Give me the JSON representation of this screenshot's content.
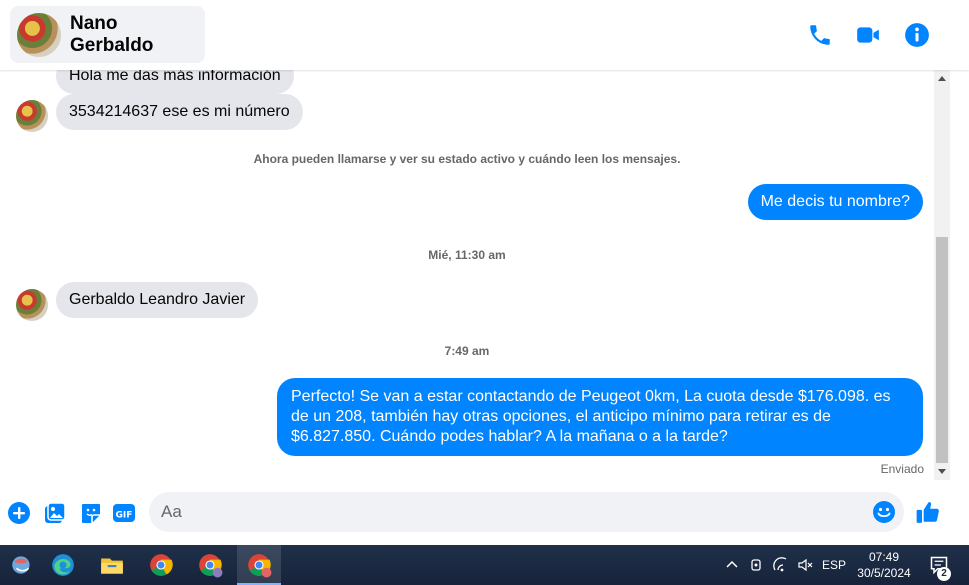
{
  "header": {
    "contact_name": "Nano Gerbaldo"
  },
  "messages": {
    "m1": "Hola me das más información",
    "m2": "3534214637 ese es mi número",
    "system_notice": "Ahora pueden llamarse y ver su estado activo y cuándo leen los mensajes.",
    "m3": "Me decis tu nombre?",
    "ts1": "Mié, 11:30 am",
    "m4": "Gerbaldo Leandro Javier",
    "ts2": "7:49 am",
    "m5_l1": "Perfecto!  Se van a estar contactando de Peugeot 0km, La cuota desde $176.098. es",
    "m5_l2": "de un 208, también hay otras opciones, el anticipo mínimo para retirar es de",
    "m5_l3": "$6.827.850. Cuándo podes hablar? A la mañana o a la tarde?",
    "status": "Enviado"
  },
  "composer": {
    "placeholder": "Aa"
  },
  "taskbar": {
    "lang": "ESP",
    "time": "07:49",
    "date": "30/5/2024",
    "notifications": "2"
  },
  "colors": {
    "accent": "#0084ff",
    "incoming_bubble": "#e4e6eb",
    "taskbar": "#1b2838"
  },
  "icons": {
    "call": "phone-icon",
    "video": "video-camera-icon",
    "info": "info-icon",
    "add": "plus-circle-icon",
    "image": "image-icon",
    "sticker": "sticker-icon",
    "gif": "gif-icon",
    "emoji": "emoji-icon",
    "like": "thumbs-up-icon"
  }
}
